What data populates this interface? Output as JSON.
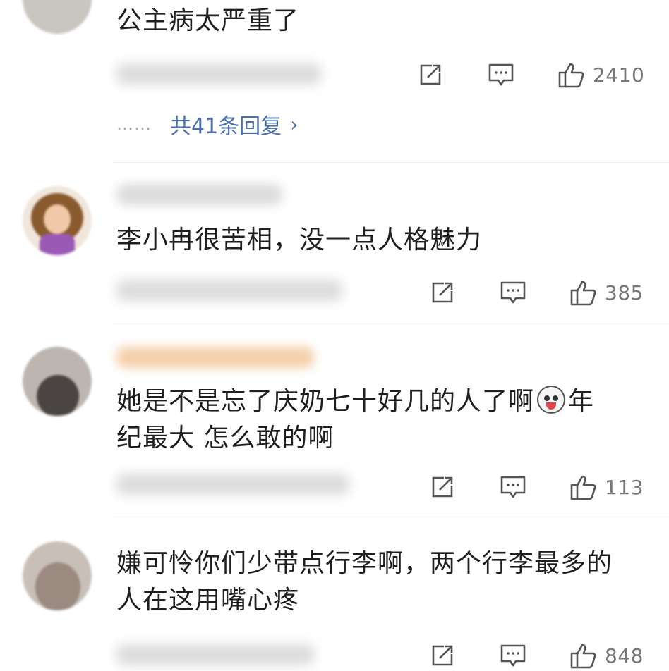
{
  "comments": [
    {
      "text": "公主病太严重了",
      "likes": "2410",
      "replies_label": "共41条回复",
      "replies_dots": "……"
    },
    {
      "text": "李小冉很苦相，没一点人格魅力",
      "likes": "385"
    },
    {
      "text_line1": "她是不是忘了庆奶七十好几的人了啊",
      "text_line1_tail": "年",
      "text_line2": "纪最大 怎么敢的啊",
      "likes": "113"
    },
    {
      "text_line1": "嫌可怜你们少带点行李啊，两个行李最多的",
      "text_line2": "人在这用嘴心疼",
      "likes": "848"
    }
  ],
  "icons": {
    "share": "share-icon",
    "reply": "comment-icon",
    "like": "thumbs-up-icon",
    "emoji": "husky-tongue-emoji"
  },
  "colors": {
    "link": "#4a6fb0",
    "icon": "#555555",
    "count": "#777777"
  }
}
